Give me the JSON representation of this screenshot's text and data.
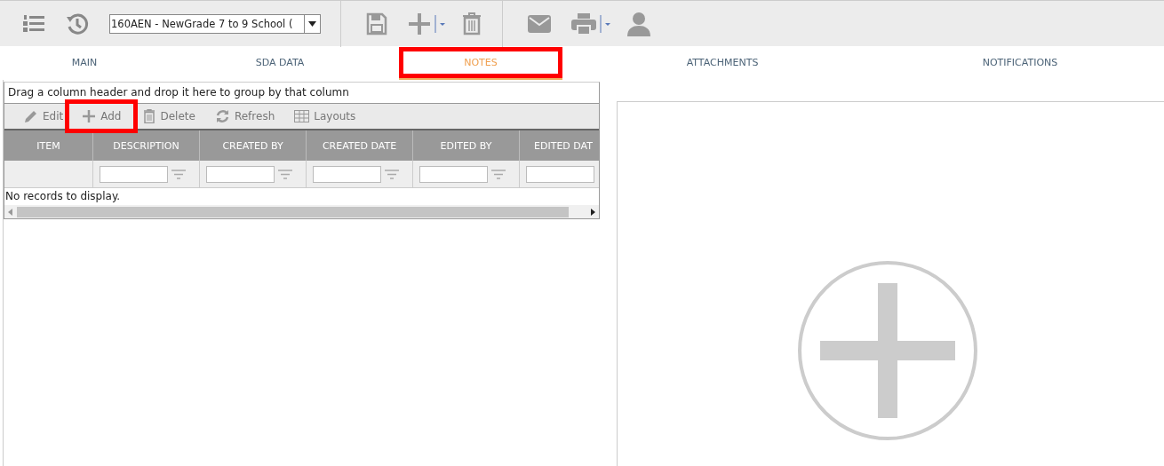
{
  "toolbar": {
    "record_select": {
      "value": "160AEN - NewGrade 7 to 9 School  ("
    }
  },
  "tabs": [
    {
      "label": "MAIN",
      "selected": false,
      "highlighted": false
    },
    {
      "label": "SDA DATA",
      "selected": false,
      "highlighted": false
    },
    {
      "label": "NOTES",
      "selected": true,
      "highlighted": true
    },
    {
      "label": "ATTACHMENTS",
      "selected": false,
      "highlighted": false
    },
    {
      "label": "NOTIFICATIONS",
      "selected": false,
      "highlighted": false
    }
  ],
  "grid": {
    "group_hint": "Drag a column header and drop it here to group by that column",
    "actions": [
      {
        "kind": "edit",
        "label": "Edit",
        "highlighted": false
      },
      {
        "kind": "add",
        "label": "Add",
        "highlighted": true
      },
      {
        "kind": "delete",
        "label": "Delete",
        "highlighted": false
      },
      {
        "kind": "refresh",
        "label": "Refresh",
        "highlighted": false
      },
      {
        "kind": "layouts",
        "label": "Layouts",
        "highlighted": false
      }
    ],
    "columns": [
      {
        "label": "ITEM",
        "filter": false
      },
      {
        "label": "DESCRIPTION",
        "filter": true
      },
      {
        "label": "CREATED BY",
        "filter": true
      },
      {
        "label": "CREATED DATE",
        "filter": true
      },
      {
        "label": "EDITED BY",
        "filter": true
      },
      {
        "label": "EDITED DAT",
        "filter": true
      }
    ],
    "empty_message": "No records to display."
  }
}
